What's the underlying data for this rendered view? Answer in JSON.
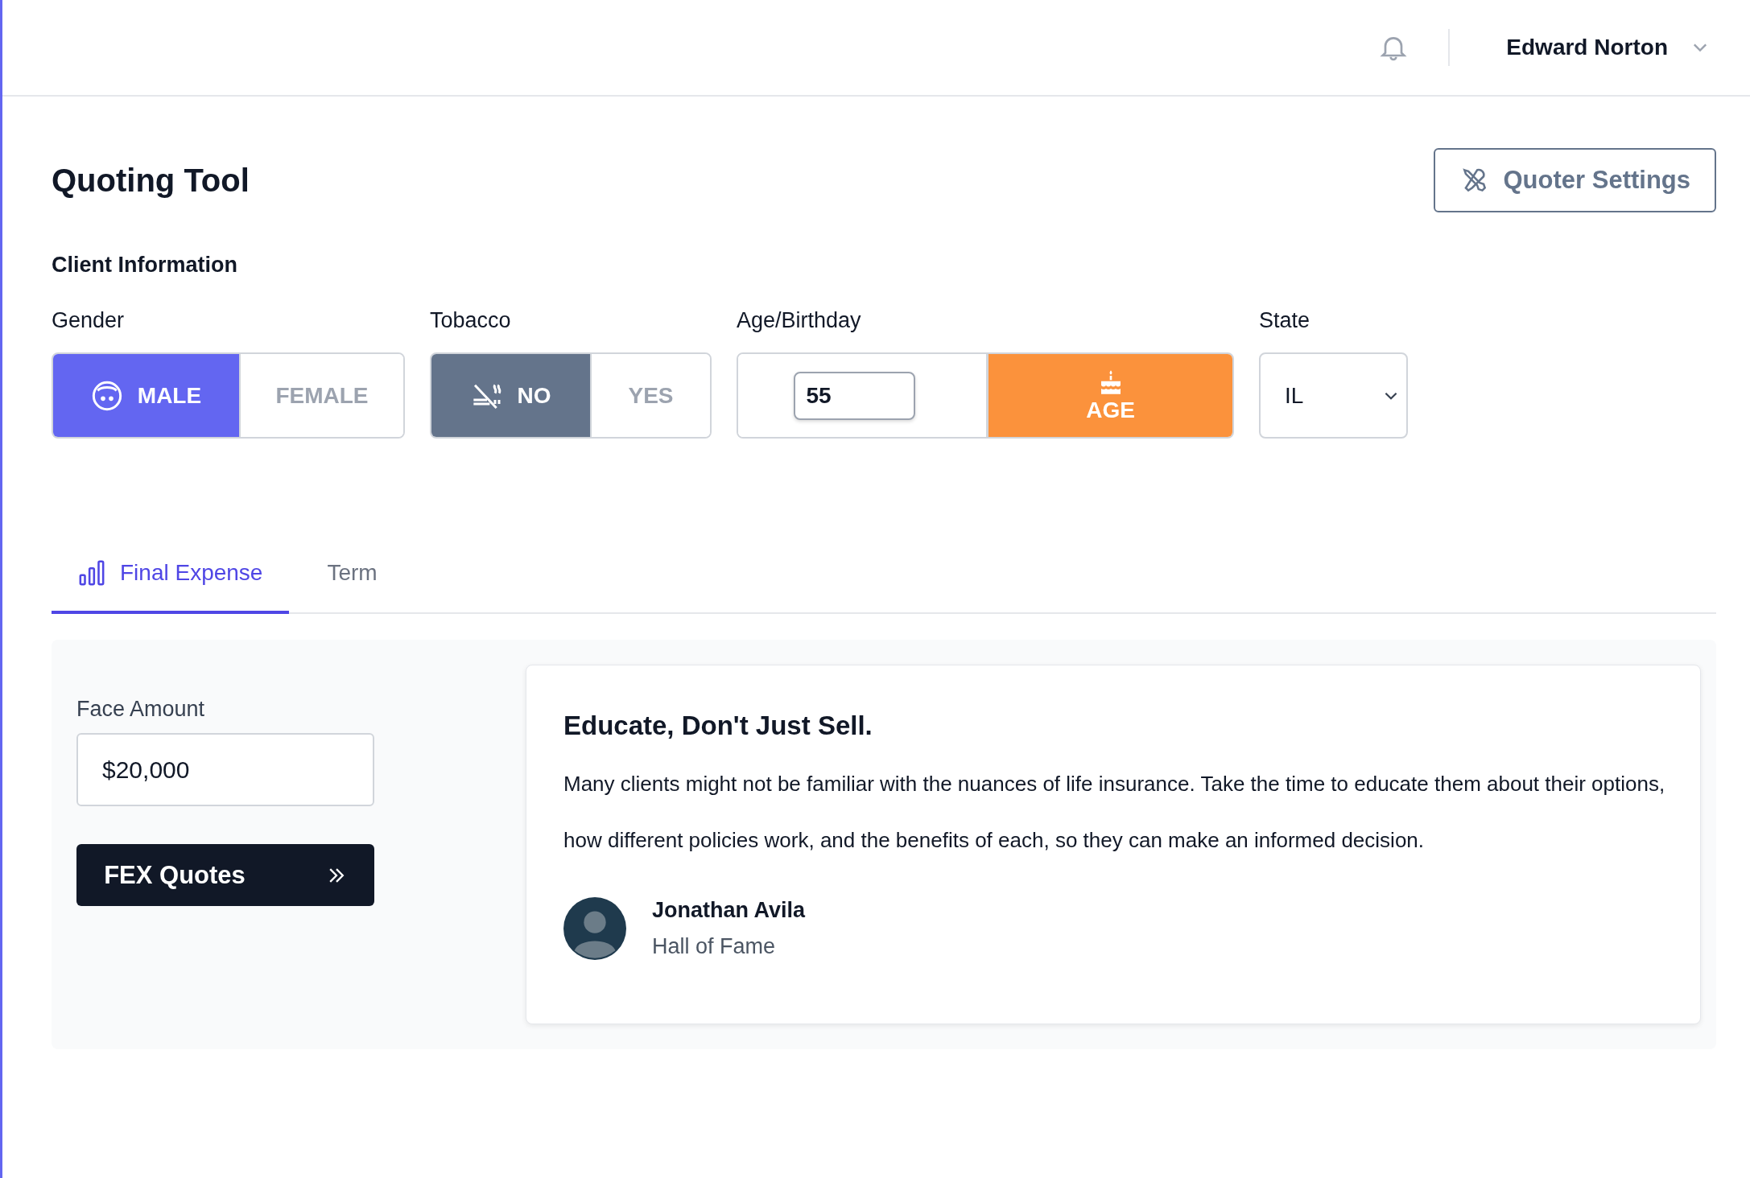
{
  "header": {
    "user_name": "Edward Norton"
  },
  "page": {
    "title": "Quoting Tool",
    "settings_button": "Quoter Settings"
  },
  "client_information": {
    "heading": "Client Information",
    "gender": {
      "label": "Gender",
      "options": [
        {
          "label": "MALE",
          "selected": true
        },
        {
          "label": "FEMALE",
          "selected": false
        }
      ]
    },
    "tobacco": {
      "label": "Tobacco",
      "options": [
        {
          "label": "NO",
          "selected": true
        },
        {
          "label": "YES",
          "selected": false
        }
      ]
    },
    "age": {
      "label": "Age/Birthday",
      "value": "55",
      "mode_button": "AGE"
    },
    "state": {
      "label": "State",
      "value": "IL"
    }
  },
  "tabs": [
    {
      "label": "Final Expense",
      "selected": true
    },
    {
      "label": "Term",
      "selected": false
    }
  ],
  "face_amount": {
    "label": "Face Amount",
    "value": "$20,000"
  },
  "quote_button": "FEX Quotes",
  "tip_card": {
    "title": "Educate, Don't Just Sell.",
    "body": "Many clients might not be familiar with the nuances of life insurance. Take the time to educate them about their options, how different policies work, and the benefits of each, so they can make an informed decision.",
    "author": "Jonathan Avila",
    "role": "Hall of Fame"
  }
}
